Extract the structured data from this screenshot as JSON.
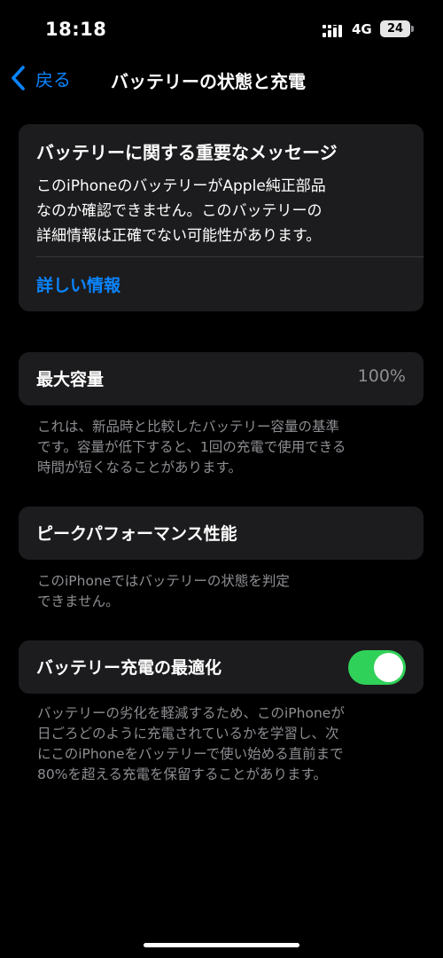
{
  "status_bar": {
    "time": "18:18",
    "network": "4G",
    "battery_level": "24",
    "signal_icon": "signal-bars-icon"
  },
  "nav": {
    "back_label": "戻る",
    "back_icon": "chevron-left-icon",
    "title": "バッテリーの状態と充電"
  },
  "important_message": {
    "title": "バッテリーに関する重要なメッセージ",
    "body": "このiPhoneのバッテリーがApple純正部品\nなのか確認できません。このバッテリーの\n詳細情報は正確でない可能性があります。",
    "link_label": "詳しい情報"
  },
  "max_capacity": {
    "label": "最大容量",
    "value": "100%",
    "footnote": "これは、新品時と比較したバッテリー容量の基準\nです。容量が低下すると、1回の充電で使用できる\n時間が短くなることがあります。"
  },
  "peak_performance": {
    "label": "ピークパフォーマンス性能",
    "footnote": "このiPhoneではバッテリーの状態を判定\nできません。"
  },
  "optimized_charging": {
    "label": "バッテリー充電の最適化",
    "enabled": true,
    "footnote": "バッテリーの劣化を軽減するため、このiPhoneが\n日ごろどのように充電されているかを学習し、次\nにこのiPhoneをバッテリーで使い始める直前まで\n80%を超える充電を保留することがあります。"
  },
  "colors": {
    "background": "#000000",
    "card": "#1c1c1e",
    "accent": "#0a84ff",
    "toggle_on": "#30d158",
    "secondary_text": "#8e8e93"
  }
}
